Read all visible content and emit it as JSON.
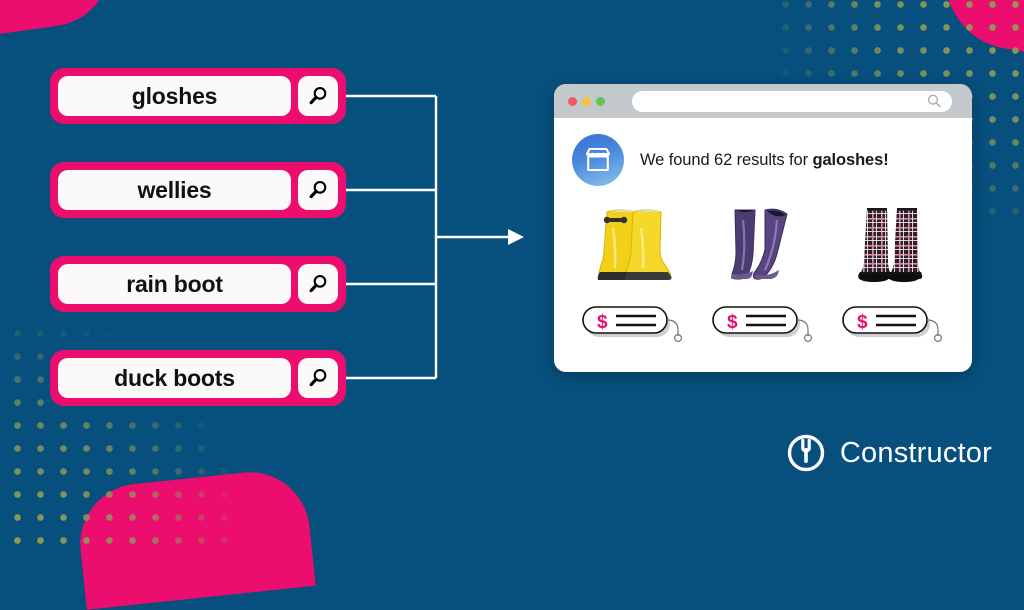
{
  "brand": {
    "name": "Constructor",
    "navy": "#074f7c",
    "pink": "#ec0e6e",
    "dot_olive": "#8d9a55"
  },
  "queries": {
    "items": [
      {
        "text": "gloshes",
        "icon": "search-icon"
      },
      {
        "text": "wellies",
        "icon": "search-icon"
      },
      {
        "text": "rain boot",
        "icon": "search-icon"
      },
      {
        "text": "duck boots",
        "icon": "search-icon"
      }
    ]
  },
  "browser": {
    "traffic_lights": [
      "red",
      "yellow",
      "green"
    ],
    "url_value": "",
    "url_placeholder": "",
    "url_icon": "search-icon",
    "store_icon": "storefront-icon",
    "result": {
      "prefix": "We found 62 results for ",
      "term": "galoshes!",
      "count": 62
    },
    "products": [
      {
        "name": "yellow-rain-boots",
        "color": "#f2d01a",
        "price_icon": "dollar-sign-icon"
      },
      {
        "name": "purple-rain-boots",
        "color": "#4b3c72",
        "price_icon": "dollar-sign-icon"
      },
      {
        "name": "plaid-rain-boots",
        "color": "#2a2228",
        "price_icon": "dollar-sign-icon"
      }
    ]
  },
  "connector": {
    "arrow_direction": "right"
  }
}
